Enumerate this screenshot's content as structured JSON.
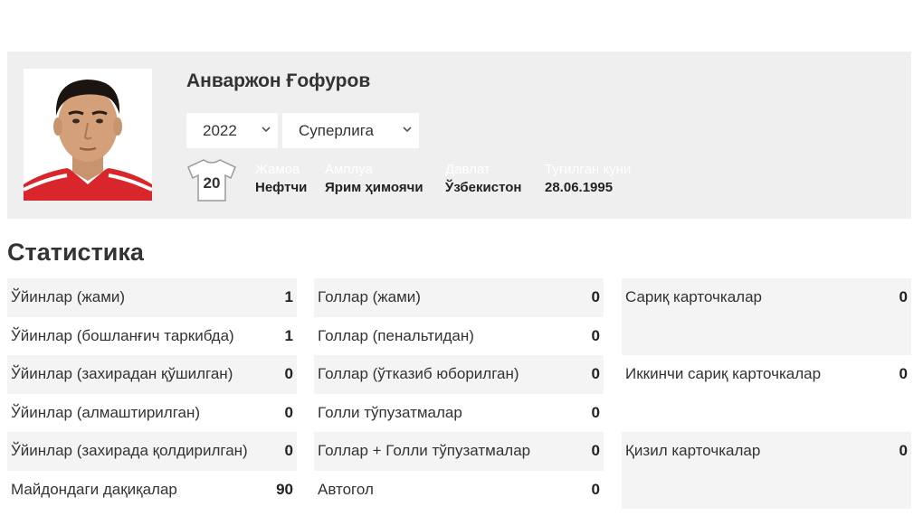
{
  "player": {
    "name": "Анваржон Ғофуров",
    "shirt_number": "20"
  },
  "filters": {
    "year": "2022",
    "league": "Суперлига"
  },
  "info": [
    {
      "label": "Жамоа",
      "value": "Нефтчи"
    },
    {
      "label": "Амплуа",
      "value": "Ярим ҳимоячи"
    },
    {
      "label": "Давлат",
      "value": "Ўзбекистон"
    },
    {
      "label": "Туғилган куни",
      "value": "28.06.1995"
    }
  ],
  "stats_heading": "Статистика",
  "stats": {
    "games": [
      {
        "label": "Ўйинлар (жами)",
        "value": "1"
      },
      {
        "label": "Ўйинлар (бошланғич таркибда)",
        "value": "1"
      },
      {
        "label": "Ўйинлар (захирадан қўшилган)",
        "value": "0"
      },
      {
        "label": "Ўйинлар (алмаштирилган)",
        "value": "0"
      },
      {
        "label": "Ўйинлар (захирада қолдирилган)",
        "value": "0"
      },
      {
        "label": "Майдондаги дақиқалар",
        "value": "90"
      }
    ],
    "goals": [
      {
        "label": "Голлар (жами)",
        "value": "0"
      },
      {
        "label": "Голлар (пенальтидан)",
        "value": "0"
      },
      {
        "label": "Голлар (ўтказиб юборилган)",
        "value": "0"
      },
      {
        "label": "Голли тўпузатмалар",
        "value": "0"
      },
      {
        "label": "Голлар + Голли тўпузатмалар",
        "value": "0"
      },
      {
        "label": "Автогол",
        "value": "0"
      }
    ],
    "cards": [
      {
        "label": "Сариқ карточкалар",
        "value": "0"
      },
      {
        "label": "Иккинчи сариқ карточкалар",
        "value": "0"
      },
      {
        "label": "Қизил карточкалар",
        "value": "0"
      }
    ]
  },
  "colors": {
    "card_bg": "#efefef",
    "row_shade": "#f4f4f4",
    "text": "#333333"
  }
}
